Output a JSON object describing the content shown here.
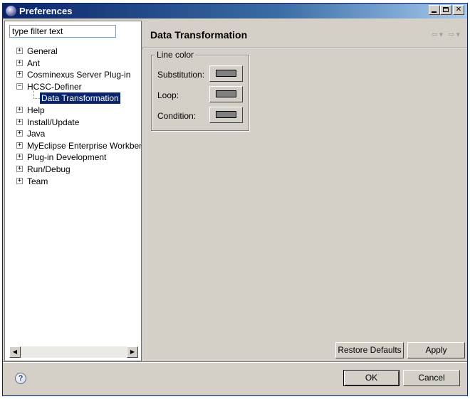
{
  "window": {
    "title": "Preferences",
    "icon": "eclipse-icon"
  },
  "filter": {
    "value": "type filter text"
  },
  "tree": {
    "items": [
      {
        "label": "General",
        "expander": "+"
      },
      {
        "label": "Ant",
        "expander": "+"
      },
      {
        "label": "Cosminexus Server Plug-in",
        "expander": "+"
      },
      {
        "label": "HCSC-Definer",
        "expander": "−"
      },
      {
        "label": "Data Transformation",
        "expander": "",
        "selected": true
      },
      {
        "label": "Help",
        "expander": "+"
      },
      {
        "label": "Install/Update",
        "expander": "+"
      },
      {
        "label": "Java",
        "expander": "+"
      },
      {
        "label": "MyEclipse Enterprise Workbench",
        "expander": "+"
      },
      {
        "label": "Plug-in Development",
        "expander": "+"
      },
      {
        "label": "Run/Debug",
        "expander": "+"
      },
      {
        "label": "Team",
        "expander": "+"
      }
    ]
  },
  "page": {
    "title": "Data Transformation",
    "group_title": "Line color",
    "rows": [
      {
        "label": "Substitution:",
        "color": "#808080"
      },
      {
        "label": "Loop:",
        "color": "#808080"
      },
      {
        "label": "Condition:",
        "color": "#808080"
      }
    ],
    "restore_label": "Restore Defaults",
    "apply_label": "Apply"
  },
  "footer": {
    "ok_label": "OK",
    "cancel_label": "Cancel",
    "help_icon": "?"
  }
}
